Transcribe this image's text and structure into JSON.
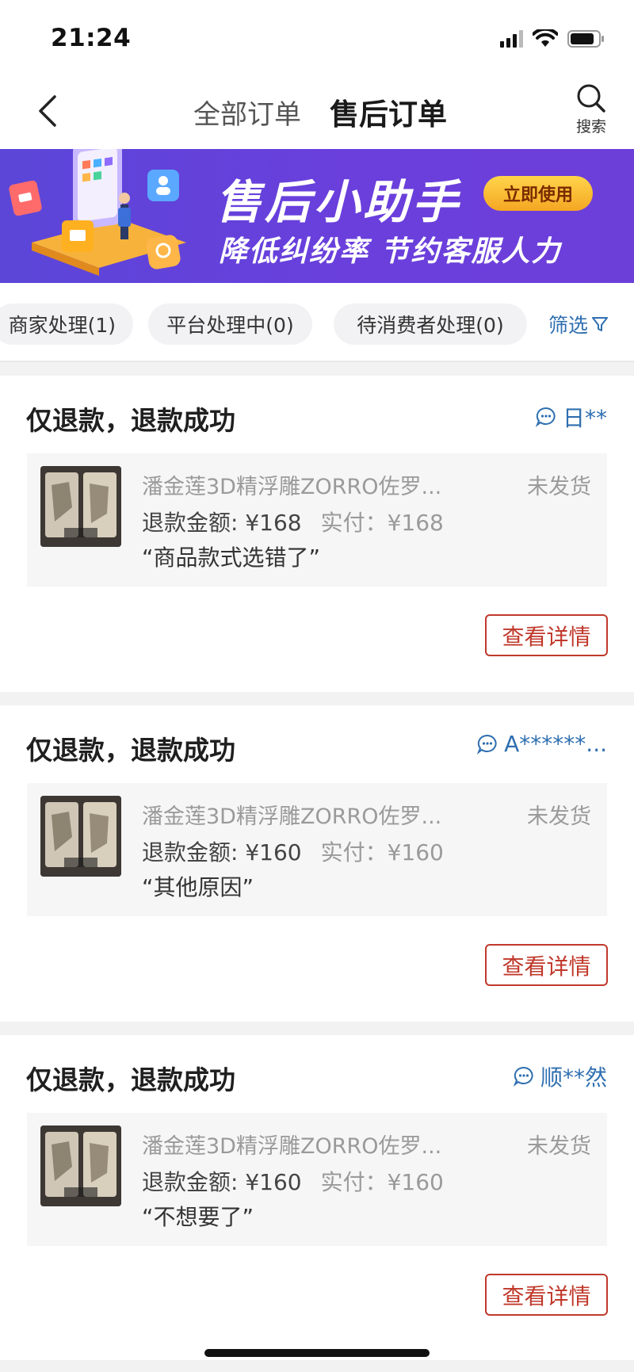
{
  "status_bar": {
    "time": "21:24"
  },
  "nav": {
    "tab_all": "全部订单",
    "tab_after_sale": "售后订单",
    "search_label": "搜索"
  },
  "banner": {
    "title": "售后小助手",
    "subtitle": "降低纠纷率 节约客服人力",
    "cta": "立即使用"
  },
  "filters": {
    "chips": [
      "商家处理(1)",
      "平台处理中(0)",
      "待消费者处理(0)"
    ],
    "filter_label": "筛选"
  },
  "orders": [
    {
      "status": "仅退款，退款成功",
      "user": "日**",
      "product_name": "潘金莲3D精浮雕ZORRO佐罗...",
      "shipping": "未发货",
      "refund_amount": "退款金额: ¥168",
      "paid": "实付：¥168",
      "reason": "“商品款式选错了”",
      "detail_label": "查看详情"
    },
    {
      "status": "仅退款，退款成功",
      "user": "A******...",
      "product_name": "潘金莲3D精浮雕ZORRO佐罗...",
      "shipping": "未发货",
      "refund_amount": "退款金额: ¥160",
      "paid": "实付：¥160",
      "reason": "“其他原因”",
      "detail_label": "查看详情"
    },
    {
      "status": "仅退款，退款成功",
      "user": "顺**然",
      "product_name": "潘金莲3D精浮雕ZORRO佐罗...",
      "shipping": "未发货",
      "refund_amount": "退款金额: ¥160",
      "paid": "实付：¥160",
      "reason": "“不想要了”",
      "detail_label": "查看详情"
    }
  ],
  "colors": {
    "accent_blue": "#2f6fb0",
    "detail_red": "#c0392b",
    "banner_purple": "#5b46d8",
    "cta_yellow": "#f5a623"
  },
  "icons": [
    "back-chevron-icon",
    "search-icon",
    "filter-funnel-icon",
    "chat-bubble-icon",
    "signal-icon",
    "wifi-icon",
    "battery-icon"
  ]
}
